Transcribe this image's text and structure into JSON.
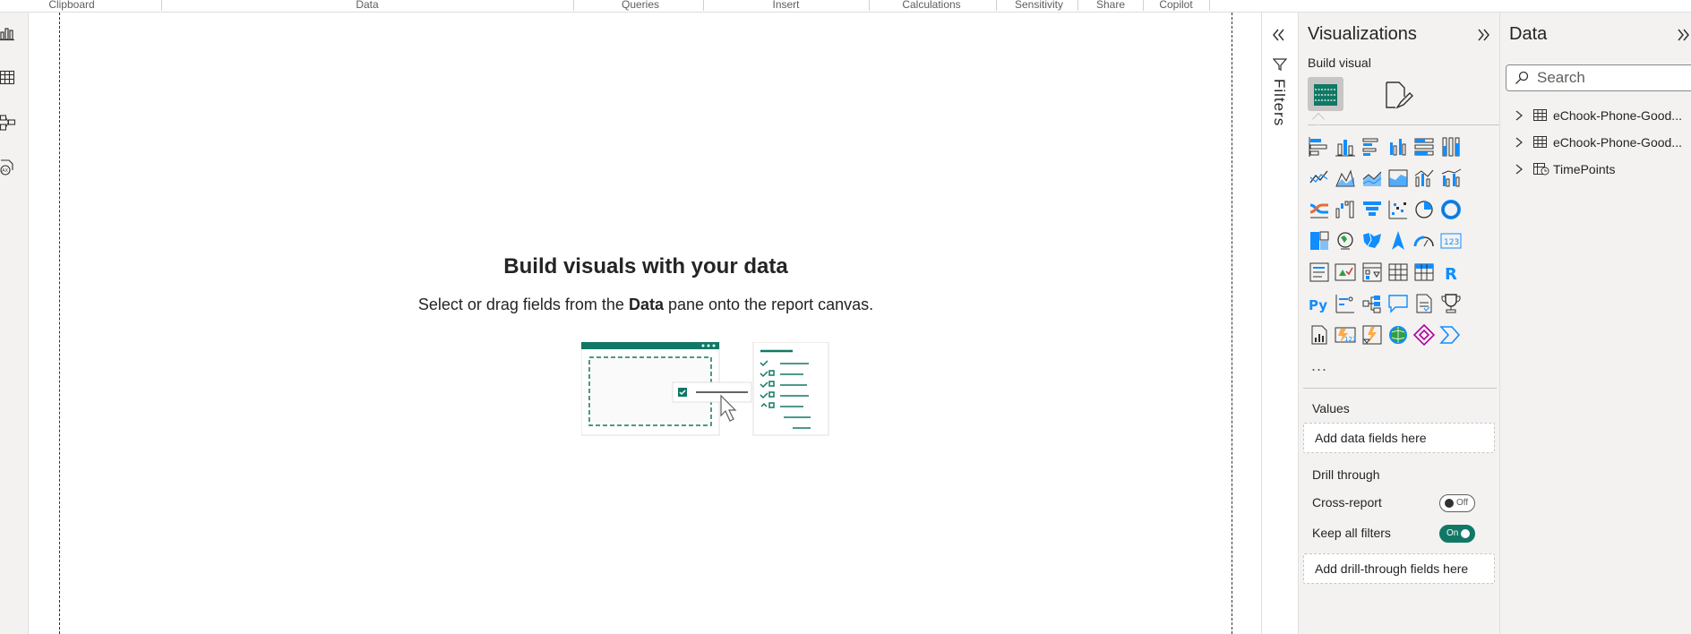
{
  "ribbon": {
    "groups": [
      "Clipboard",
      "Data",
      "Queries",
      "Insert",
      "Calculations",
      "Sensitivity",
      "Share",
      "Copilot"
    ]
  },
  "left_rail": {
    "icons": [
      "report-view-icon",
      "table-view-icon",
      "model-view-icon",
      "dax-query-view-icon"
    ]
  },
  "canvas": {
    "empty_title": "Build visuals with your data",
    "empty_sub_pre": "Select or drag fields from the",
    "empty_sub_bold": "Data",
    "empty_sub_post": "pane onto the report canvas."
  },
  "filters": {
    "label": "Filters"
  },
  "visualizations": {
    "title": "Visualizations",
    "build_visual": "Build visual",
    "more": "...",
    "values_label": "Values",
    "values_placeholder": "Add data fields here",
    "drill_through_label": "Drill through",
    "cross_report_label": "Cross-report",
    "cross_report_state": "Off",
    "keep_all_filters_label": "Keep all filters",
    "keep_all_filters_state": "On",
    "drill_placeholder": "Add drill-through fields here",
    "python_glyph": "Py",
    "r_glyph": "R",
    "card_glyph": "123"
  },
  "data_pane": {
    "title": "Data",
    "search_placeholder": "Search",
    "items": [
      {
        "label": "eChook-Phone-Good..."
      },
      {
        "label": "eChook-Phone-Good..."
      },
      {
        "label": "TimePoints"
      }
    ]
  },
  "colors": {
    "accent": "#117865",
    "viz_blue": "#118dff",
    "viz_dark": "#323130"
  }
}
